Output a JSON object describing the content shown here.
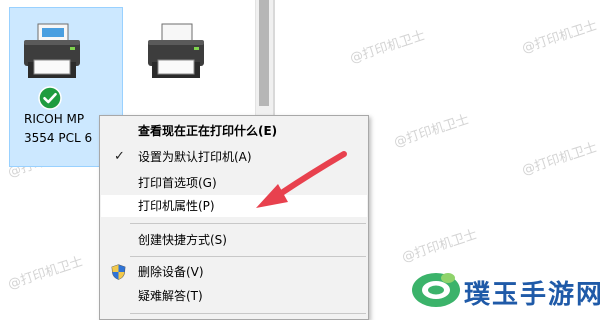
{
  "printers": [
    {
      "name_line1": "RICOH MP",
      "name_line2": "3554 PCL 6",
      "selected": true,
      "is_default": true,
      "icon": "printer-icon"
    },
    {
      "icon": "printer-icon",
      "selected": false
    }
  ],
  "context_menu": {
    "items": [
      {
        "label": "查看现在正在打印什么(E)",
        "bold": true
      },
      {
        "label": "设置为默认打印机(A)",
        "checked": true
      },
      {
        "label": "打印首选项(G)"
      },
      {
        "label": "打印机属性(P)",
        "highlighted": true
      },
      {
        "label": "创建快捷方式(S)"
      },
      {
        "label": "删除设备(V)",
        "icon": "uac-shield-icon"
      },
      {
        "label": "疑难解答(T)"
      }
    ]
  },
  "watermarks": [
    "@打印机卫士"
  ],
  "brand": {
    "text": "璞玉手游网",
    "color": "#1f5aa8",
    "logo": "jade-logo-icon"
  },
  "annotation": {
    "arrow_color": "#e8414e",
    "points_to": "打印机属性(P)"
  }
}
